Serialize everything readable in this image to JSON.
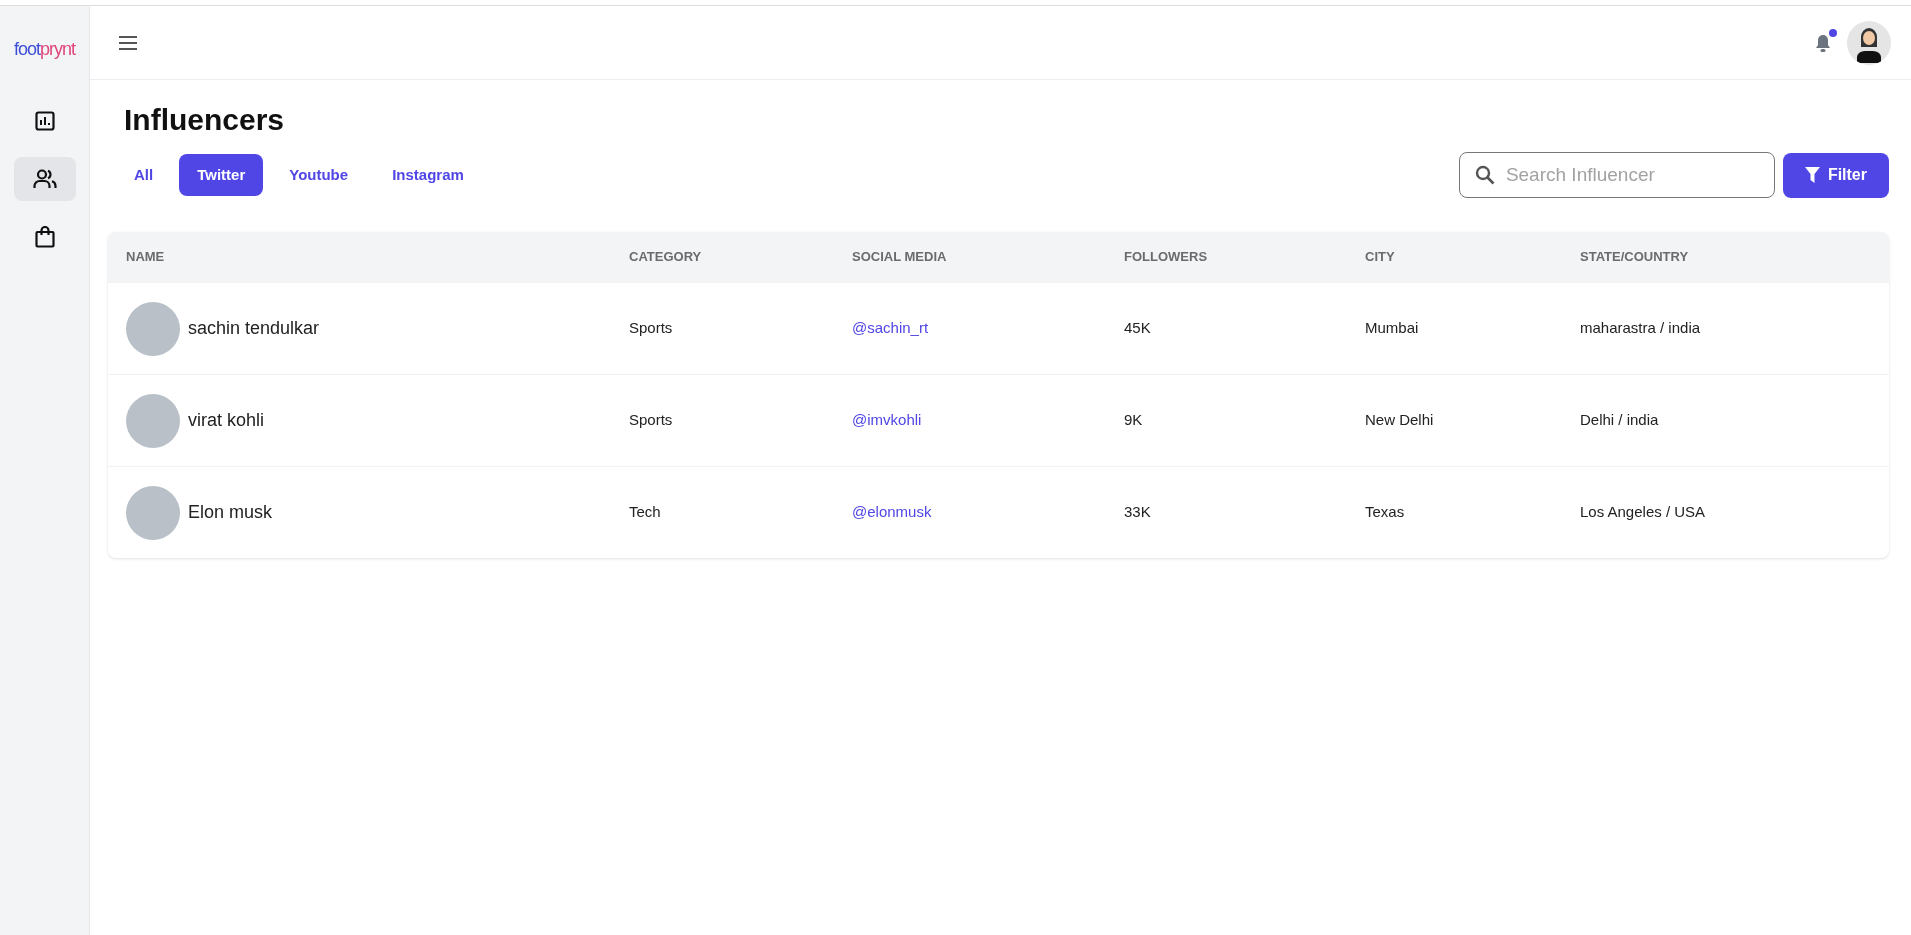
{
  "sidebar": {
    "logo": [
      {
        "text": "foot",
        "color": "#3d4ed6"
      },
      {
        "text": "prynt",
        "color": "#e0457b"
      }
    ],
    "items": [
      {
        "kind": "chart",
        "selected": false
      },
      {
        "kind": "users",
        "selected": true
      },
      {
        "kind": "bag",
        "selected": false
      }
    ]
  },
  "topbar": {
    "notification": {
      "unread": true
    }
  },
  "page": {
    "title": "Influencers",
    "tabs": [
      {
        "label": "All",
        "selected": false
      },
      {
        "label": "Twitter",
        "selected": true
      },
      {
        "label": "Youtube",
        "selected": false
      },
      {
        "label": "Instagram",
        "selected": false
      }
    ],
    "search": {
      "placeholder": "Search Influencer"
    },
    "filter_button": "Filter"
  },
  "table": {
    "columns": [
      "NAME",
      "CATEGORY",
      "SOCIAL MEDIA",
      "FOLLOWERS",
      "CITY",
      "STATE/COUNTRY"
    ],
    "rows": [
      {
        "name": "sachin tendulkar",
        "category": "Sports",
        "handle": "@sachin_rt",
        "followers": "45K",
        "city": "Mumbai",
        "state_country": "maharastra / india"
      },
      {
        "name": "virat kohli",
        "category": "Sports",
        "handle": "@imvkohli",
        "followers": "9K",
        "city": "New Delhi",
        "state_country": "Delhi / india"
      },
      {
        "name": "Elon musk",
        "category": "Tech",
        "handle": "@elonmusk",
        "followers": "33K",
        "city": "Texas",
        "state_country": "Los Angeles / USA"
      }
    ]
  }
}
